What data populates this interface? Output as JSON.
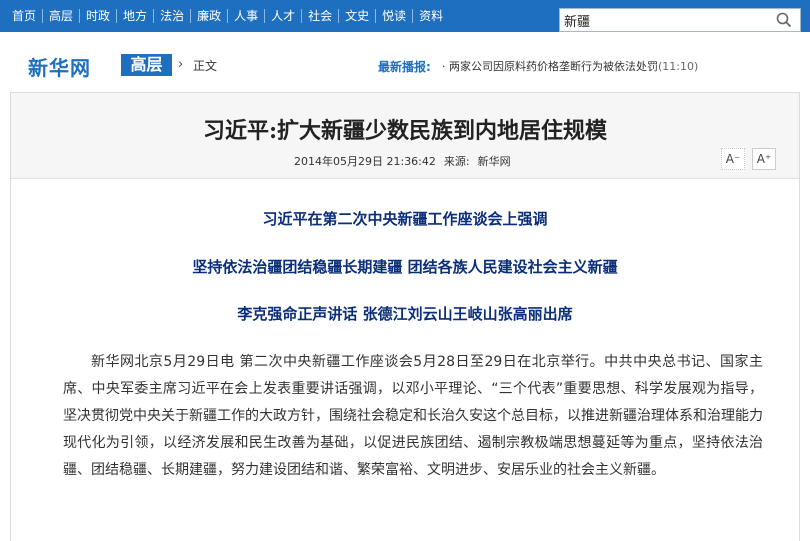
{
  "nav": {
    "items": [
      "首页",
      "高层",
      "时政",
      "地方",
      "法治",
      "廉政",
      "人事",
      "人才",
      "社会",
      "文史",
      "悦读",
      "资料"
    ]
  },
  "search": {
    "value": "新疆"
  },
  "brand": {
    "logo": "新华网",
    "channel": "高层",
    "crumb": "正文"
  },
  "latest": {
    "label": "最新播报:",
    "item": "· 两家公司因原料药价格垄断行为被依法处罚",
    "time": "(11:10)"
  },
  "article": {
    "title": "习近平:扩大新疆少数民族到内地居住规模",
    "date": "2014年05月29日 21:36:42",
    "source_label": "来源:",
    "source": "新华网",
    "font_minus": "A⁻",
    "font_plus": "A⁺",
    "subtitles": [
      "习近平在第二次中央新疆工作座谈会上强调",
      "坚持依法治疆团结稳疆长期建疆 团结各族人民建设社会主义新疆",
      "李克强命正声讲话 张德江刘云山王岐山张高丽出席"
    ],
    "paragraph": "新华网北京5月29日电  第二次中央新疆工作座谈会5月28日至29日在北京举行。中共中央总书记、国家主席、中央军委主席习近平在会上发表重要讲话强调，以邓小平理论、“三个代表”重要思想、科学发展观为指导，坚决贯彻党中央关于新疆工作的大政方针，围绕社会稳定和长治久安这个总目标，以推进新疆治理体系和治理能力现代化为引领，以经济发展和民生改善为基础，以促进民族团结、遏制宗教极端思想蔓延等为重点，坚持依法治疆、团结稳疆、长期建疆，努力建设团结和谐、繁荣富裕、文明进步、安居乐业的社会主义新疆。"
  },
  "colors": {
    "brand_blue": "#1e6fc0",
    "subtitle_navy": "#0b2e7a"
  }
}
